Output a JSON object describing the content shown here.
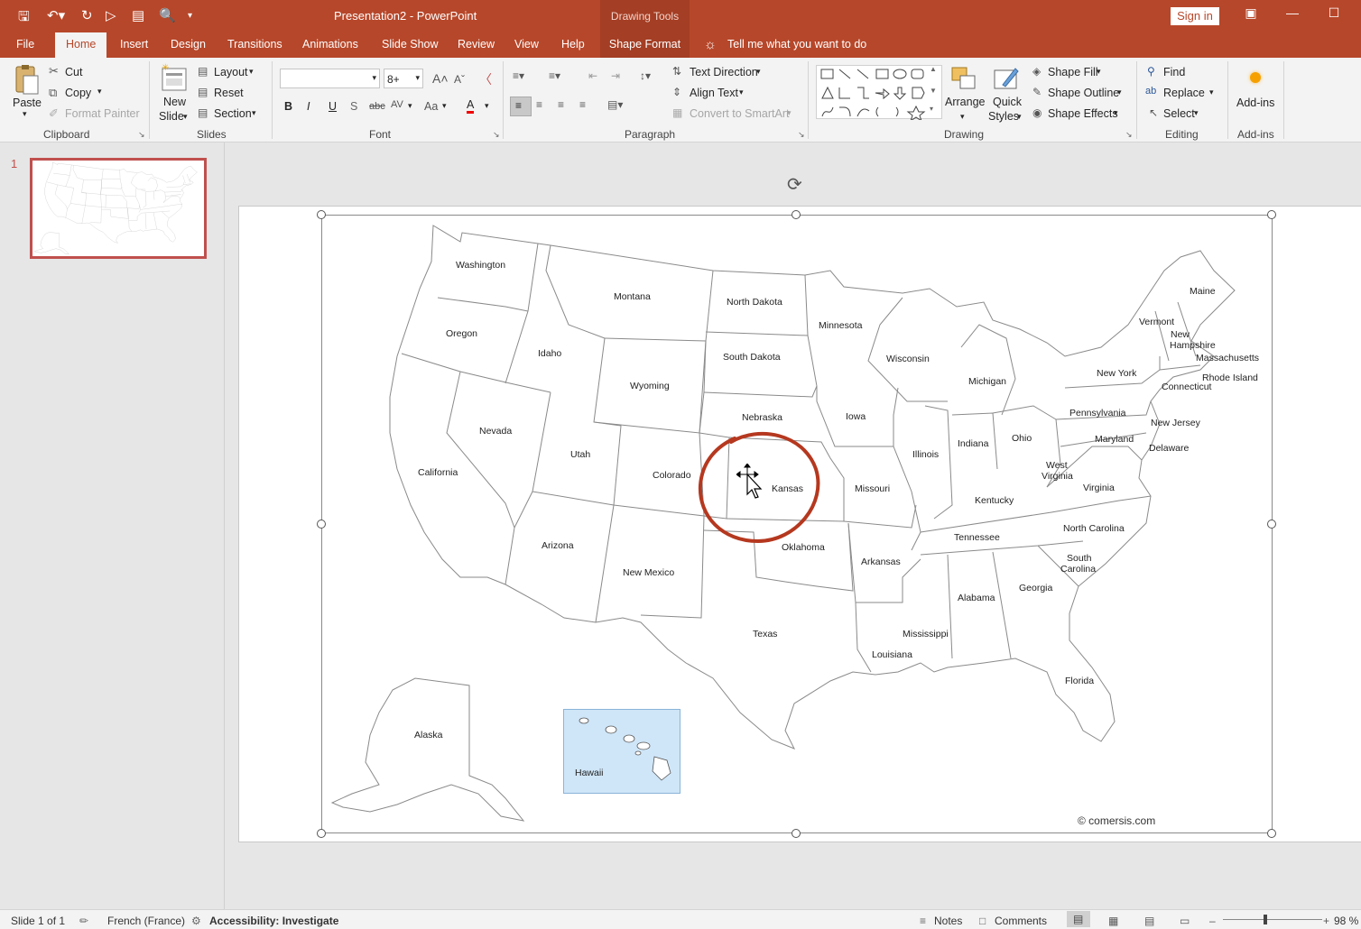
{
  "app": {
    "title": "Presentation2  -  PowerPoint",
    "contextual_group": "Drawing Tools",
    "signin": "Sign in"
  },
  "tabs": [
    "File",
    "Home",
    "Insert",
    "Design",
    "Transitions",
    "Animations",
    "Slide Show",
    "Review",
    "View",
    "Help",
    "Shape Format"
  ],
  "active_tab": "Home",
  "tell_me": "Tell me what you want to do",
  "ribbon": {
    "clipboard": {
      "paste": "Paste",
      "cut": "Cut",
      "copy": "Copy",
      "format_painter": "Format Painter",
      "label": "Clipboard"
    },
    "slides": {
      "new_slide_1": "New",
      "new_slide_2": "Slide",
      "layout": "Layout",
      "reset": "Reset",
      "section": "Section",
      "label": "Slides"
    },
    "font": {
      "font_name": "",
      "font_size": "8+",
      "bold": "B",
      "italic": "I",
      "underline": "U",
      "shadow": "S",
      "strike": "abc",
      "spacing": "AV",
      "case": "Aa",
      "color": "A",
      "label": "Font"
    },
    "paragraph": {
      "text_direction": "Text Direction",
      "align_text": "Align Text",
      "smartart": "Convert to SmartArt",
      "label": "Paragraph"
    },
    "drawing": {
      "arrange": "Arrange",
      "quick_styles_1": "Quick",
      "quick_styles_2": "Styles",
      "shape_fill": "Shape Fill",
      "shape_outline": "Shape Outline",
      "shape_effects": "Shape Effects",
      "label": "Drawing"
    },
    "editing": {
      "find": "Find",
      "replace": "Replace",
      "select": "Select",
      "label": "Editing"
    },
    "addins": {
      "addins": "Add-ins",
      "label": "Add-ins"
    }
  },
  "slide_pane": {
    "slide_number": "1"
  },
  "map": {
    "states": {
      "washington": "Washington",
      "oregon": "Oregon",
      "california": "California",
      "idaho": "Idaho",
      "nevada": "Nevada",
      "montana": "Montana",
      "wyoming": "Wyoming",
      "utah": "Utah",
      "arizona": "Arizona",
      "colorado": "Colorado",
      "new_mexico": "New Mexico",
      "north_dakota": "North Dakota",
      "south_dakota": "South Dakota",
      "nebraska": "Nebraska",
      "kansas": "Kansas",
      "oklahoma": "Oklahoma",
      "texas": "Texas",
      "minnesota": "Minnesota",
      "iowa": "Iowa",
      "missouri": "Missouri",
      "arkansas": "Arkansas",
      "louisiana": "Louisiana",
      "wisconsin": "Wisconsin",
      "illinois": "Illinois",
      "michigan": "Michigan",
      "indiana": "Indiana",
      "ohio": "Ohio",
      "kentucky": "Kentucky",
      "tennessee": "Tennessee",
      "mississippi": "Mississippi",
      "alabama": "Alabama",
      "georgia": "Georgia",
      "florida": "Florida",
      "south_carolina_1": "South",
      "south_carolina_2": "Carolina",
      "north_carolina": "North Carolina",
      "virginia": "Virginia",
      "west_virginia_1": "West",
      "west_virginia_2": "Virginia",
      "pennsylvania": "Pennsylvania",
      "new_york": "New York",
      "maryland": "Maryland",
      "delaware": "Delaware",
      "new_jersey": "New Jersey",
      "connecticut": "Connecticut",
      "rhode_island": "Rhode Island",
      "massachusetts": "Massachusetts",
      "new_hampshire_1": "New",
      "new_hampshire_2": "Hampshire",
      "vermont": "Vermont",
      "maine": "Maine",
      "alaska": "Alaska",
      "hawaii": "Hawaii"
    },
    "copyright": "© comersis.com"
  },
  "status": {
    "slide_of": "Slide 1 of 1",
    "language": "French (France)",
    "accessibility": "Accessibility: Investigate",
    "notes": "Notes",
    "comments": "Comments",
    "zoom": "98 %"
  },
  "colors": {
    "accent": "#b7472a",
    "highlight_circle": "#b5381f"
  }
}
